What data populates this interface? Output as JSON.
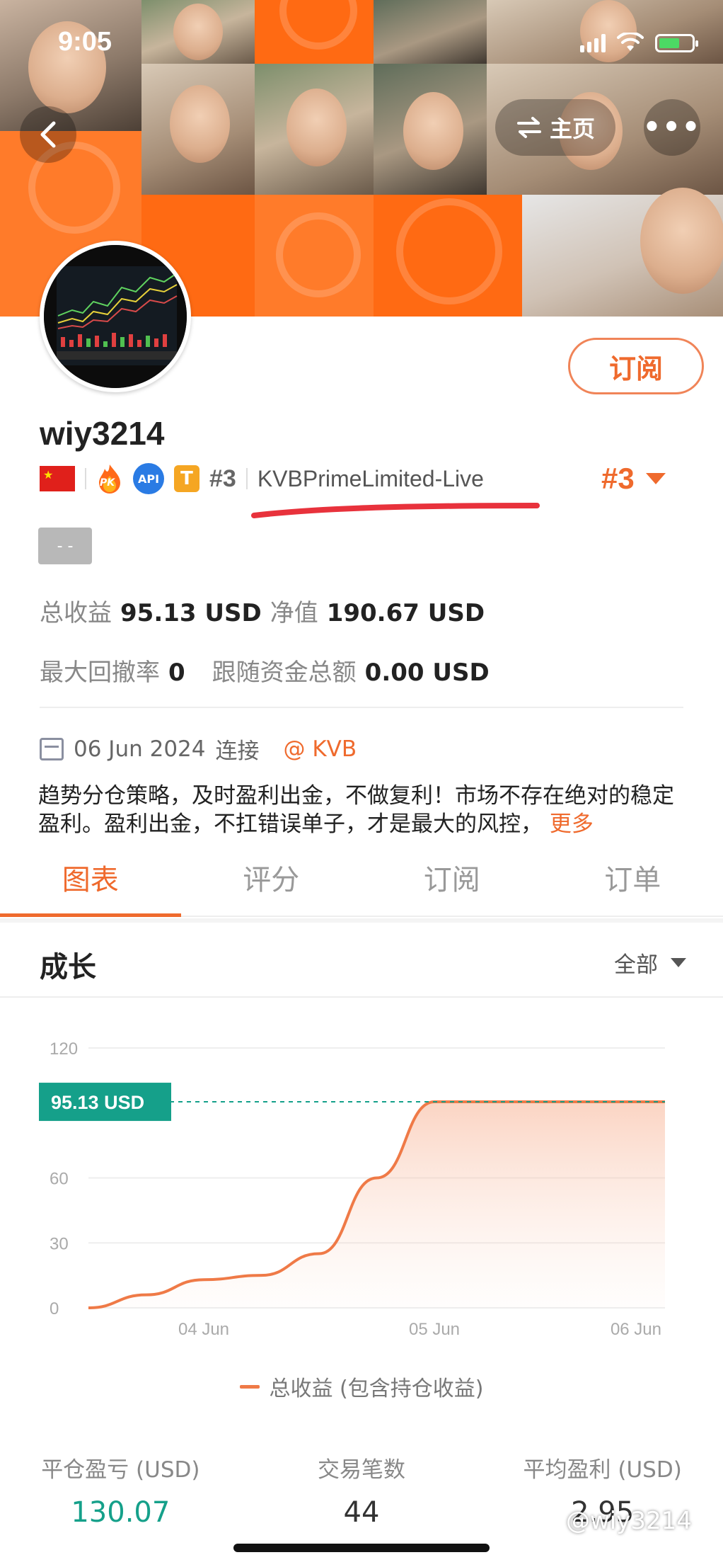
{
  "status_bar": {
    "time": "9:05"
  },
  "nav": {
    "home_label": "主页",
    "more_label": "•••"
  },
  "profile": {
    "subscribe_label": "订阅",
    "username": "wiy3214",
    "badge_pk": "PK",
    "badge_api": "API",
    "badge_t": "T",
    "rank_small": "#3",
    "broker": "KVBPrimeLimited-Live",
    "rank_big": "#3",
    "tag_placeholder": "- -"
  },
  "stats": {
    "total_profit_label": "总收益",
    "total_profit_value": "95.13 USD",
    "equity_label": "净值",
    "equity_value": "190.67 USD",
    "max_drawdown_label": "最大回撤率",
    "max_drawdown_value": "0",
    "follow_total_label": "跟随资金总额",
    "follow_total_value": "0.00 USD"
  },
  "connection": {
    "date": "06 Jun 2024",
    "connect_label": "连接",
    "broker_tag": "@ KVB"
  },
  "description": {
    "text": "趋势分仓策略，及时盈利出金，不做复利！市场不存在绝对的稳定盈利。盈利出金，不扛错误单子，才是最大的风控，",
    "more": "更多"
  },
  "tabs": [
    {
      "label": "图表",
      "active": true
    },
    {
      "label": "评分",
      "active": false
    },
    {
      "label": "订阅",
      "active": false
    },
    {
      "label": "订单",
      "active": false
    }
  ],
  "growth": {
    "title": "成长",
    "filter": "全部"
  },
  "chart_data": {
    "type": "area",
    "x_ticks": [
      "04 Jun",
      "05 Jun",
      "06 Jun"
    ],
    "y_ticks": [
      "0",
      "30",
      "60",
      "120"
    ],
    "ylim": [
      0,
      120
    ],
    "current_label": "95.13 USD",
    "current_value": 95.13,
    "series": [
      {
        "name": "总收益 (包含持仓收益)",
        "color": "#ef7a47",
        "points": [
          {
            "x": "03 Jun 12:00",
            "y": 0
          },
          {
            "x": "03 Jun 18:00",
            "y": 6
          },
          {
            "x": "04 Jun 00:00",
            "y": 13
          },
          {
            "x": "04 Jun 06:00",
            "y": 15
          },
          {
            "x": "04 Jun 12:00",
            "y": 25
          },
          {
            "x": "04 Jun 18:00",
            "y": 60
          },
          {
            "x": "05 Jun 00:00",
            "y": 95.13
          },
          {
            "x": "06 Jun 00:00",
            "y": 95.13
          }
        ]
      }
    ]
  },
  "bottom_stats": [
    {
      "label": "平仓盈亏 (USD)",
      "value": "130.07"
    },
    {
      "label": "交易笔数",
      "value": "44"
    },
    {
      "label": "平均盈利 (USD)",
      "value": "2.95"
    }
  ],
  "watermark": "@wiy3214"
}
